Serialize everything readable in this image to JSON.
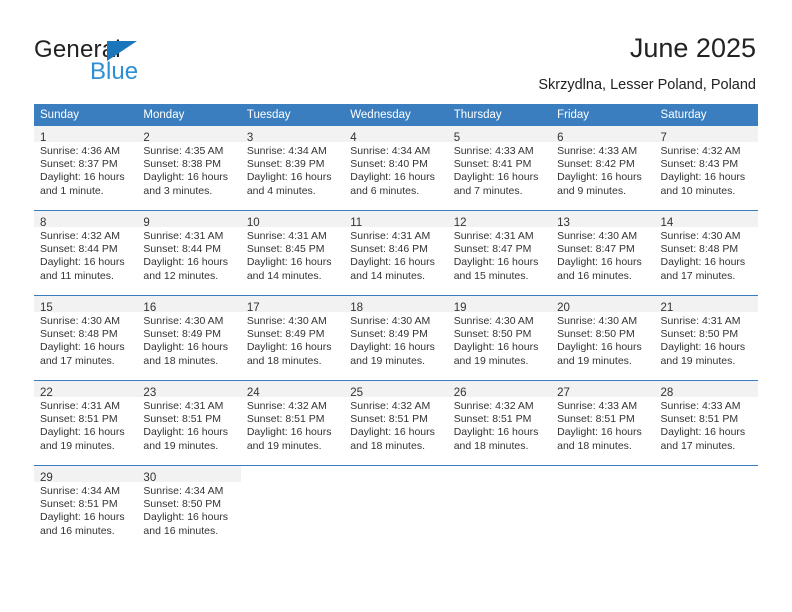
{
  "brand": {
    "name_part1": "General",
    "name_part2": "Blue",
    "triangle_color": "#1b76bb",
    "blue_text_color": "#2e8fd4"
  },
  "header": {
    "title": "June 2025",
    "subtitle": "Skrzydlna, Lesser Poland, Poland"
  },
  "theme": {
    "header_bg": "#3a7ebf",
    "header_text": "#ffffff",
    "daynum_band_bg": "#f2f2f2",
    "row_separator": "#3a7ebf",
    "body_text": "#333333"
  },
  "calendar": {
    "weekday_headers": [
      "Sunday",
      "Monday",
      "Tuesday",
      "Wednesday",
      "Thursday",
      "Friday",
      "Saturday"
    ],
    "weeks": [
      [
        {
          "day": "1",
          "sunrise": "Sunrise: 4:36 AM",
          "sunset": "Sunset: 8:37 PM",
          "daylight": "Daylight: 16 hours and 1 minute."
        },
        {
          "day": "2",
          "sunrise": "Sunrise: 4:35 AM",
          "sunset": "Sunset: 8:38 PM",
          "daylight": "Daylight: 16 hours and 3 minutes."
        },
        {
          "day": "3",
          "sunrise": "Sunrise: 4:34 AM",
          "sunset": "Sunset: 8:39 PM",
          "daylight": "Daylight: 16 hours and 4 minutes."
        },
        {
          "day": "4",
          "sunrise": "Sunrise: 4:34 AM",
          "sunset": "Sunset: 8:40 PM",
          "daylight": "Daylight: 16 hours and 6 minutes."
        },
        {
          "day": "5",
          "sunrise": "Sunrise: 4:33 AM",
          "sunset": "Sunset: 8:41 PM",
          "daylight": "Daylight: 16 hours and 7 minutes."
        },
        {
          "day": "6",
          "sunrise": "Sunrise: 4:33 AM",
          "sunset": "Sunset: 8:42 PM",
          "daylight": "Daylight: 16 hours and 9 minutes."
        },
        {
          "day": "7",
          "sunrise": "Sunrise: 4:32 AM",
          "sunset": "Sunset: 8:43 PM",
          "daylight": "Daylight: 16 hours and 10 minutes."
        }
      ],
      [
        {
          "day": "8",
          "sunrise": "Sunrise: 4:32 AM",
          "sunset": "Sunset: 8:44 PM",
          "daylight": "Daylight: 16 hours and 11 minutes."
        },
        {
          "day": "9",
          "sunrise": "Sunrise: 4:31 AM",
          "sunset": "Sunset: 8:44 PM",
          "daylight": "Daylight: 16 hours and 12 minutes."
        },
        {
          "day": "10",
          "sunrise": "Sunrise: 4:31 AM",
          "sunset": "Sunset: 8:45 PM",
          "daylight": "Daylight: 16 hours and 14 minutes."
        },
        {
          "day": "11",
          "sunrise": "Sunrise: 4:31 AM",
          "sunset": "Sunset: 8:46 PM",
          "daylight": "Daylight: 16 hours and 14 minutes."
        },
        {
          "day": "12",
          "sunrise": "Sunrise: 4:31 AM",
          "sunset": "Sunset: 8:47 PM",
          "daylight": "Daylight: 16 hours and 15 minutes."
        },
        {
          "day": "13",
          "sunrise": "Sunrise: 4:30 AM",
          "sunset": "Sunset: 8:47 PM",
          "daylight": "Daylight: 16 hours and 16 minutes."
        },
        {
          "day": "14",
          "sunrise": "Sunrise: 4:30 AM",
          "sunset": "Sunset: 8:48 PM",
          "daylight": "Daylight: 16 hours and 17 minutes."
        }
      ],
      [
        {
          "day": "15",
          "sunrise": "Sunrise: 4:30 AM",
          "sunset": "Sunset: 8:48 PM",
          "daylight": "Daylight: 16 hours and 17 minutes."
        },
        {
          "day": "16",
          "sunrise": "Sunrise: 4:30 AM",
          "sunset": "Sunset: 8:49 PM",
          "daylight": "Daylight: 16 hours and 18 minutes."
        },
        {
          "day": "17",
          "sunrise": "Sunrise: 4:30 AM",
          "sunset": "Sunset: 8:49 PM",
          "daylight": "Daylight: 16 hours and 18 minutes."
        },
        {
          "day": "18",
          "sunrise": "Sunrise: 4:30 AM",
          "sunset": "Sunset: 8:49 PM",
          "daylight": "Daylight: 16 hours and 19 minutes."
        },
        {
          "day": "19",
          "sunrise": "Sunrise: 4:30 AM",
          "sunset": "Sunset: 8:50 PM",
          "daylight": "Daylight: 16 hours and 19 minutes."
        },
        {
          "day": "20",
          "sunrise": "Sunrise: 4:30 AM",
          "sunset": "Sunset: 8:50 PM",
          "daylight": "Daylight: 16 hours and 19 minutes."
        },
        {
          "day": "21",
          "sunrise": "Sunrise: 4:31 AM",
          "sunset": "Sunset: 8:50 PM",
          "daylight": "Daylight: 16 hours and 19 minutes."
        }
      ],
      [
        {
          "day": "22",
          "sunrise": "Sunrise: 4:31 AM",
          "sunset": "Sunset: 8:51 PM",
          "daylight": "Daylight: 16 hours and 19 minutes."
        },
        {
          "day": "23",
          "sunrise": "Sunrise: 4:31 AM",
          "sunset": "Sunset: 8:51 PM",
          "daylight": "Daylight: 16 hours and 19 minutes."
        },
        {
          "day": "24",
          "sunrise": "Sunrise: 4:32 AM",
          "sunset": "Sunset: 8:51 PM",
          "daylight": "Daylight: 16 hours and 19 minutes."
        },
        {
          "day": "25",
          "sunrise": "Sunrise: 4:32 AM",
          "sunset": "Sunset: 8:51 PM",
          "daylight": "Daylight: 16 hours and 18 minutes."
        },
        {
          "day": "26",
          "sunrise": "Sunrise: 4:32 AM",
          "sunset": "Sunset: 8:51 PM",
          "daylight": "Daylight: 16 hours and 18 minutes."
        },
        {
          "day": "27",
          "sunrise": "Sunrise: 4:33 AM",
          "sunset": "Sunset: 8:51 PM",
          "daylight": "Daylight: 16 hours and 18 minutes."
        },
        {
          "day": "28",
          "sunrise": "Sunrise: 4:33 AM",
          "sunset": "Sunset: 8:51 PM",
          "daylight": "Daylight: 16 hours and 17 minutes."
        }
      ],
      [
        {
          "day": "29",
          "sunrise": "Sunrise: 4:34 AM",
          "sunset": "Sunset: 8:51 PM",
          "daylight": "Daylight: 16 hours and 16 minutes."
        },
        {
          "day": "30",
          "sunrise": "Sunrise: 4:34 AM",
          "sunset": "Sunset: 8:50 PM",
          "daylight": "Daylight: 16 hours and 16 minutes."
        },
        {
          "day": "",
          "sunrise": "",
          "sunset": "",
          "daylight": ""
        },
        {
          "day": "",
          "sunrise": "",
          "sunset": "",
          "daylight": ""
        },
        {
          "day": "",
          "sunrise": "",
          "sunset": "",
          "daylight": ""
        },
        {
          "day": "",
          "sunrise": "",
          "sunset": "",
          "daylight": ""
        },
        {
          "day": "",
          "sunrise": "",
          "sunset": "",
          "daylight": ""
        }
      ]
    ]
  }
}
